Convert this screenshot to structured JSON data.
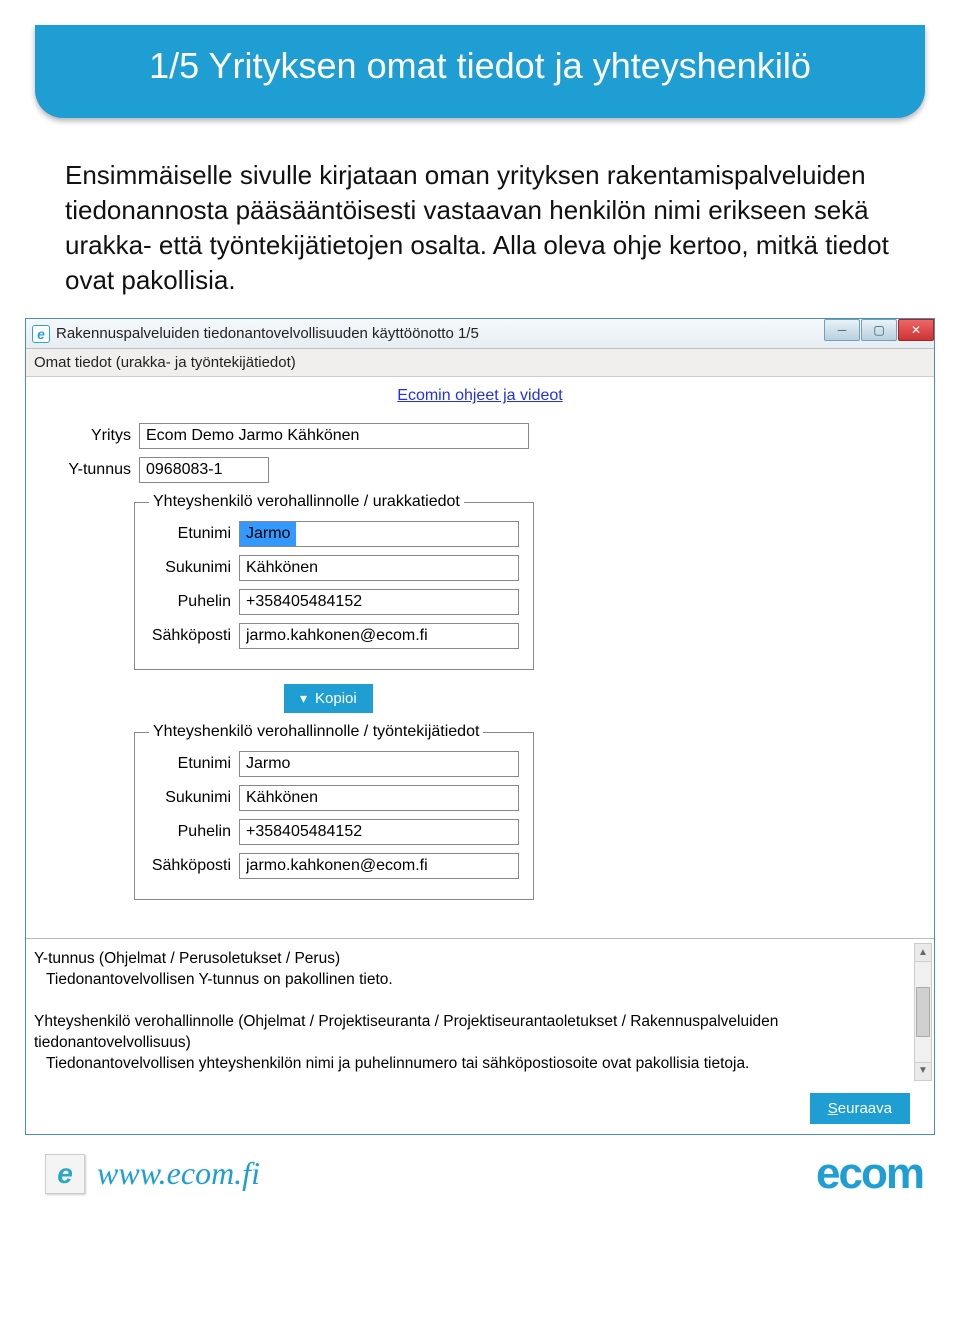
{
  "header": {
    "title": "1/5 Yrityksen omat tiedot ja yhteyshenkilö"
  },
  "intro": "Ensimmäiselle sivulle kirjataan oman yrityksen rakentamispalveluiden tiedonannosta pääsääntöisesti vastaavan henkilön nimi erikseen sekä urakka- että työntekijätietojen osalta. Alla oleva ohje kertoo, mitkä tiedot ovat pakollisia.",
  "app": {
    "icon_glyph": "e",
    "title": "Rakennuspalveluiden tiedonantovelvollisuuden käyttöönotto 1/5",
    "win": {
      "min": "__",
      "max": "❐",
      "close": "✕"
    },
    "subheader": "Omat tiedot (urakka- ja työntekijätiedot)",
    "help_link": "Ecomin ohjeet ja videot",
    "labels": {
      "yritys": "Yritys",
      "ytunnus": "Y-tunnus",
      "etunimi": "Etunimi",
      "sukunimi": "Sukunimi",
      "puhelin": "Puhelin",
      "sahkoposti": "Sähköposti"
    },
    "fields": {
      "yritys": "Ecom Demo Jarmo Kähkönen",
      "ytunnus": "0968083-1"
    },
    "group1": {
      "legend": "Yhteyshenkilö verohallinnolle / urakkatiedot",
      "etunimi": "Jarmo",
      "sukunimi": "Kähkönen",
      "puhelin": "+358405484152",
      "sahkoposti": "jarmo.kahkonen@ecom.fi"
    },
    "copy_button": "Kopioi",
    "group2": {
      "legend": "Yhteyshenkilö verohallinnolle / työntekijätiedot",
      "etunimi": "Jarmo",
      "sukunimi": "Kähkönen",
      "puhelin": "+358405484152",
      "sahkoposti": "jarmo.kahkonen@ecom.fi"
    },
    "info": {
      "line1": "Y-tunnus (Ohjelmat / Perusoletukset / Perus)",
      "line2": "Tiedonantovelvollisen Y-tunnus on pakollinen tieto.",
      "line3": "Yhteyshenkilö verohallinnolle (Ohjelmat / Projektiseuranta / Projektiseurantaoletukset / Rakennuspalveluiden tiedonantovelvollisuus)",
      "line4": "Tiedonantovelvollisen yhteyshenkilön nimi ja puhelinnumero tai sähköpostiosoite ovat pakollisia tietoja."
    },
    "next_button": "Seuraava"
  },
  "footer": {
    "url": "www.ecom.fi",
    "logo": "ecom",
    "icon_glyph": "e"
  }
}
